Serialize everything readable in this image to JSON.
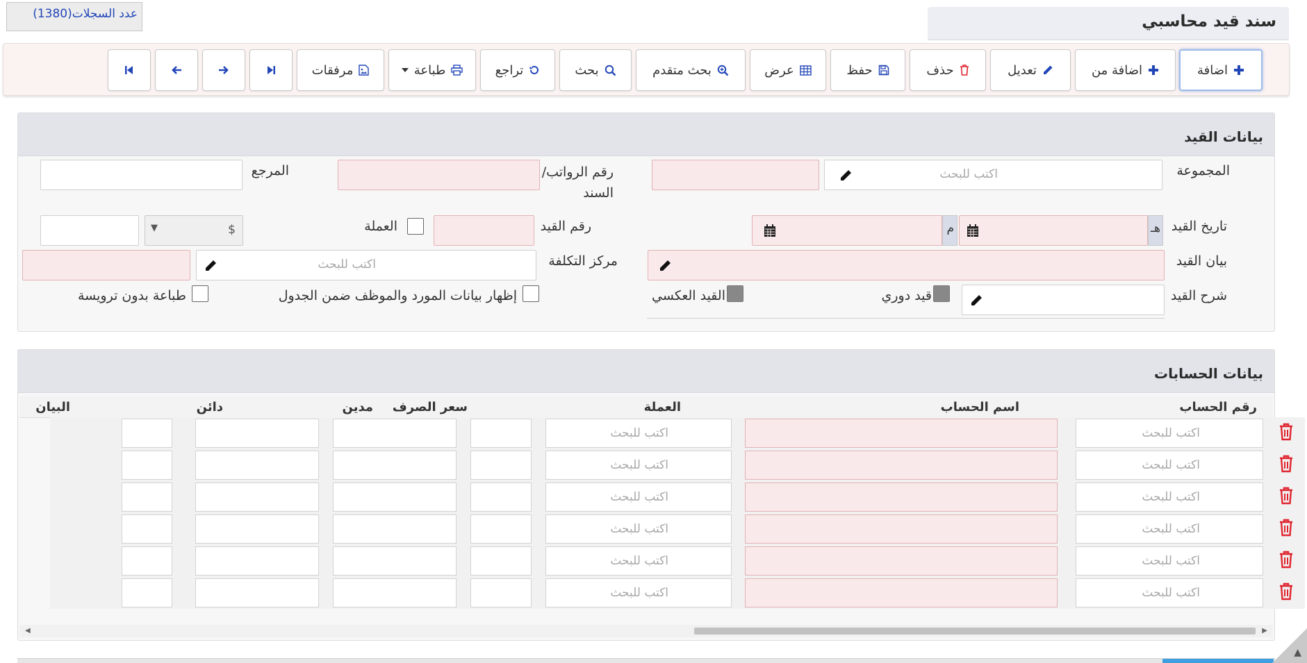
{
  "header": {
    "title": "سند قيد محاسبي",
    "records_count": "عدد السجلات(1380)"
  },
  "toolbar": {
    "add": "اضافة",
    "add_from": "اضافة من",
    "edit": "تعديل",
    "delete": "حذف",
    "save": "حفظ",
    "view": "عرض",
    "advanced_search": "بحث متقدم",
    "search": "بحث",
    "undo": "تراجع",
    "print": "طباعة",
    "attachments": "مرفقات"
  },
  "entry_panel": {
    "title": "بيانات القيد",
    "group_label": "المجموعة",
    "group_placeholder": "اكتب للبحث",
    "payroll_label": "رقم الرواتب/ السند",
    "reference_label": "المرجع",
    "date_label": "تاريخ القيد",
    "hijri_suffix": "هـ",
    "gregorian_suffix": "م",
    "entry_no_label": "رقم القيد",
    "currency_label": "العملة",
    "currency_symbol": "$",
    "statement_label": "بيان القيد",
    "cost_center_label": "مركز التكلفة",
    "cost_center_placeholder": "اكتب للبحث",
    "explanation_label": "شرح القيد",
    "periodic_label": "قيد دوري",
    "reverse_label": "القيد العكسي",
    "show_supplier_label": "إظهار بيانات المورد والموظف ضمن الجدول",
    "print_no_header_label": "طباعة بدون ترويسة"
  },
  "accounts_panel": {
    "title": "بيانات الحسابات",
    "columns": [
      "رقم الحساب",
      "اسم الحساب",
      "العملة",
      "سعر الصرف",
      "مدين",
      "دائن",
      "البيان"
    ],
    "search_placeholder": "اكتب للبحث",
    "row_count": 6
  },
  "colors": {
    "accent": "#2246b8",
    "delete_red": "#e0252f",
    "required_bg": "#fae9ea"
  }
}
